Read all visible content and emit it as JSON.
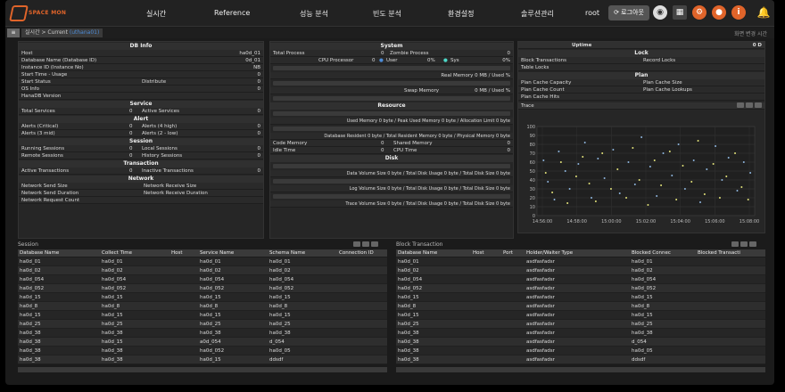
{
  "app": {
    "logo_text": "SPACE MON"
  },
  "nav": [
    {
      "label": "실시간"
    },
    {
      "label": "Reference"
    },
    {
      "label": "성능 분석"
    },
    {
      "label": "빈도 분석"
    },
    {
      "label": "환경설정"
    },
    {
      "label": "솔루션관리"
    }
  ],
  "user": {
    "name": "root",
    "logout_label": "로그아웃"
  },
  "tabs": {
    "menu_icon": "≡",
    "current": "실시간 > Current",
    "sub": "(uthana01)",
    "right_info": "화면 변경 시간"
  },
  "db_info": {
    "title": "DB Info",
    "rows": [
      {
        "label": "Host",
        "value": "ha0d_01"
      },
      {
        "label": "Database Name (Database ID)",
        "value": "0d_01"
      },
      {
        "label": "Instance ID (Instance No)",
        "value": "NB"
      },
      {
        "label": "Start Time - Usage",
        "value": "0"
      },
      {
        "label": "Start Status",
        "mid": "Distribute",
        "value": "0"
      },
      {
        "label": "OS Info",
        "value": "0"
      },
      {
        "label": "HanaDB Version",
        "value": ""
      }
    ]
  },
  "service": {
    "title": "Service",
    "left": "Total Services",
    "left_val": "0",
    "right": "Active Services",
    "right_val": "0"
  },
  "alert": {
    "title": "Alert",
    "rows": [
      {
        "left": "Alerts (Critical)",
        "left_val": "0",
        "right": "Alerts (4 high)",
        "right_val": "0"
      },
      {
        "left": "Alerts (3 mid)",
        "left_val": "0",
        "right": "Alerts (2 - low)",
        "right_val": "0"
      }
    ]
  },
  "session": {
    "title": "Session",
    "rows": [
      {
        "left": "Running Sessions",
        "left_val": "0",
        "right": "Local Sessions",
        "right_val": "0"
      },
      {
        "left": "Remote Sessions",
        "left_val": "0",
        "right": "History Sessions",
        "right_val": "0"
      }
    ]
  },
  "transaction": {
    "title": "Transaction",
    "left": "Active Transactions",
    "left_val": "0",
    "right": "Inactive Transactions",
    "right_val": "0"
  },
  "network": {
    "title": "Network",
    "rows": [
      {
        "left": "Network Send Size",
        "right": "Network Receive Size"
      },
      {
        "left": "Network Send Duration",
        "right": "Network Receive Duration"
      },
      {
        "left": "Network Request Count",
        "right": ""
      }
    ]
  },
  "system": {
    "title": "System",
    "total_process": "Total Process",
    "total_process_val": "0",
    "zombie_process": "Zombie Process",
    "zombie_process_val": "0",
    "cpu_label": "CPU Processor",
    "cpu_val": "0",
    "user_label": "User",
    "user_val": "0%",
    "sys_label": "Sys",
    "sys_val": "0%",
    "real_memory": "Real Memory 0 MB / Used %",
    "swap_memory": "Swap Memory",
    "swap_val": "0 MB / Used %"
  },
  "resource": {
    "title": "Resource",
    "used_memory": "Used Memory 0 byte / Peak Used Memory 0 byte / Allocation Limit 0 byte",
    "db_resident": "Database Resident 0 byte / Total Resident Memory 0 byte / Physical Memory 0 byte",
    "code_memory": "Code Memory",
    "code_memory_val": "0",
    "shared_memory": "Shared Memory",
    "shared_memory_val": "0",
    "idle_time": "Idle Time",
    "idle_time_val": "0",
    "cpu_time": "CPU Time",
    "cpu_time_val": "0"
  },
  "disk": {
    "title": "Disk",
    "data_volume": "Data Volume Size 0 byte / Total Disk Usage 0 byte / Total Disk Size 0 byte",
    "log_volume": "Log Volume Size 0 byte / Total Disk Usage 0 byte / Total Disk Size 0 byte",
    "trace_volume": "Trace Volume Size 0 byte / Total Disk Usage 0 byte / Total Disk Size 0 byte"
  },
  "uptime": {
    "label": "Uptime",
    "value": "0 D"
  },
  "lock": {
    "title": "Lock",
    "block_transactions": "Block Transactions",
    "record_locks": "Record Locks",
    "table_locks": "Table Locks"
  },
  "plan": {
    "title": "Plan",
    "rows": [
      {
        "left": "Plan Cache Capacity",
        "right": "Plan Cache Size"
      },
      {
        "left": "Plan Cache Count",
        "right": "Plan Cache Lookups"
      },
      {
        "left": "Plan Cache Hits",
        "right": ""
      }
    ]
  },
  "trace": {
    "title": "Trace"
  },
  "chart_data": {
    "type": "scatter",
    "title": "Trace",
    "ylim": [
      0,
      100
    ],
    "yticks": [
      "100",
      "90",
      "80",
      "70",
      "60",
      "50",
      "40",
      "30",
      "20",
      "10",
      "0"
    ],
    "xticks": [
      "14:56:00",
      "14:58:00",
      "15:00:00",
      "15:02:00",
      "15:04:00",
      "15:06:00",
      "15:08:00"
    ],
    "grid": true,
    "series": [
      {
        "color": "#8fb7e0",
        "points": [
          [
            0.03,
            62
          ],
          [
            0.05,
            38
          ],
          [
            0.08,
            18
          ],
          [
            0.1,
            72
          ],
          [
            0.13,
            50
          ],
          [
            0.15,
            30
          ],
          [
            0.19,
            58
          ],
          [
            0.22,
            82
          ],
          [
            0.25,
            20
          ],
          [
            0.28,
            64
          ],
          [
            0.31,
            42
          ],
          [
            0.35,
            74
          ],
          [
            0.38,
            25
          ],
          [
            0.42,
            60
          ],
          [
            0.45,
            35
          ],
          [
            0.48,
            88
          ],
          [
            0.52,
            55
          ],
          [
            0.55,
            22
          ],
          [
            0.58,
            70
          ],
          [
            0.62,
            45
          ],
          [
            0.65,
            80
          ],
          [
            0.68,
            30
          ],
          [
            0.72,
            62
          ],
          [
            0.75,
            15
          ],
          [
            0.78,
            52
          ],
          [
            0.82,
            78
          ],
          [
            0.85,
            40
          ],
          [
            0.88,
            65
          ],
          [
            0.92,
            28
          ],
          [
            0.95,
            60
          ],
          [
            0.98,
            48
          ]
        ]
      },
      {
        "color": "#e4e47a",
        "points": [
          [
            0.04,
            48
          ],
          [
            0.07,
            26
          ],
          [
            0.11,
            60
          ],
          [
            0.14,
            14
          ],
          [
            0.18,
            44
          ],
          [
            0.21,
            66
          ],
          [
            0.24,
            36
          ],
          [
            0.27,
            16
          ],
          [
            0.3,
            70
          ],
          [
            0.34,
            30
          ],
          [
            0.37,
            52
          ],
          [
            0.41,
            20
          ],
          [
            0.44,
            76
          ],
          [
            0.47,
            40
          ],
          [
            0.51,
            12
          ],
          [
            0.54,
            62
          ],
          [
            0.57,
            34
          ],
          [
            0.61,
            72
          ],
          [
            0.64,
            18
          ],
          [
            0.67,
            56
          ],
          [
            0.71,
            38
          ],
          [
            0.74,
            84
          ],
          [
            0.77,
            24
          ],
          [
            0.81,
            58
          ],
          [
            0.84,
            20
          ],
          [
            0.87,
            44
          ],
          [
            0.91,
            70
          ],
          [
            0.94,
            32
          ],
          [
            0.97,
            18
          ]
        ]
      }
    ]
  },
  "session_table": {
    "title": "Session",
    "columns": [
      "Database Name",
      "Collect Time",
      "Host",
      "Service Name",
      "Schema Name",
      "Connection ID"
    ],
    "rows": [
      [
        "ha0d_01",
        "ha0d_01",
        "",
        "ha0d_01",
        "ha0d_01",
        ""
      ],
      [
        "ha0d_02",
        "ha0d_02",
        "",
        "ha0d_02",
        "ha0d_02",
        ""
      ],
      [
        "ha0d_054",
        "ha0d_054",
        "",
        "ha0d_054",
        "ha0d_054",
        ""
      ],
      [
        "ha0d_052",
        "ha0d_052",
        "",
        "ha0d_052",
        "ha0d_052",
        ""
      ],
      [
        "ha0d_15",
        "ha0d_15",
        "",
        "ha0d_15",
        "ha0d_15",
        ""
      ],
      [
        "ha0d_8",
        "ha0d_8",
        "",
        "ha0d_8",
        "ha0d_8",
        ""
      ],
      [
        "ha0d_15",
        "ha0d_15",
        "",
        "ha0d_15",
        "ha0d_15",
        ""
      ],
      [
        "ha0d_25",
        "ha0d_25",
        "",
        "ha0d_25",
        "ha0d_25",
        ""
      ],
      [
        "ha0d_38",
        "ha0d_38",
        "",
        "ha0d_38",
        "ha0d_38",
        ""
      ],
      [
        "ha0d_38",
        "ha0d_15",
        "",
        "a0d_054",
        "d_054",
        ""
      ],
      [
        "ha0d_38",
        "ha0d_38",
        "",
        "ha0d_052",
        "ha0d_05",
        ""
      ],
      [
        "ha0d_38",
        "ha0d_38",
        "",
        "ha0d_15",
        "ddsdf",
        ""
      ]
    ]
  },
  "block_table": {
    "title": "Block Transaction",
    "columns": [
      "Database Name",
      "Host",
      "Port",
      "Holder/Waiter Type",
      "Blocked Connec",
      "Blocked Transacti"
    ],
    "rows": [
      [
        "ha0d_01",
        "",
        "",
        "asdfasfadsr",
        "ha0d_01",
        ""
      ],
      [
        "ha0d_02",
        "",
        "",
        "asdfasfadsr",
        "ha0d_02",
        ""
      ],
      [
        "ha0d_054",
        "",
        "",
        "asdfasfadsr",
        "ha0d_054",
        ""
      ],
      [
        "ha0d_052",
        "",
        "",
        "asdfasfadsr",
        "ha0d_052",
        ""
      ],
      [
        "ha0d_15",
        "",
        "",
        "asdfasfadsr",
        "ha0d_15",
        ""
      ],
      [
        "ha0d_8",
        "",
        "",
        "asdfasfadsr",
        "ha0d_8",
        ""
      ],
      [
        "ha0d_15",
        "",
        "",
        "asdfasfadsr",
        "ha0d_15",
        ""
      ],
      [
        "ha0d_25",
        "",
        "",
        "asdfasfadsr",
        "ha0d_25",
        ""
      ],
      [
        "ha0d_38",
        "",
        "",
        "asdfasfadsr",
        "ha0d_38",
        ""
      ],
      [
        "ha0d_38",
        "",
        "",
        "asdfasfadsr",
        "d_054",
        ""
      ],
      [
        "ha0d_38",
        "",
        "",
        "asdfasfadsr",
        "ha0d_05",
        ""
      ],
      [
        "ha0d_38",
        "",
        "",
        "asdfasfadsr",
        "ddsdf",
        ""
      ]
    ]
  },
  "colors": {
    "accent": "#e0642a",
    "link": "#4d8cd8",
    "bg": "#1b1b1b",
    "panel": "#262626"
  },
  "icons": [
    "globe-icon",
    "grid-icon",
    "settings-icon",
    "alarm-icon",
    "info-icon",
    "bell-icon"
  ]
}
